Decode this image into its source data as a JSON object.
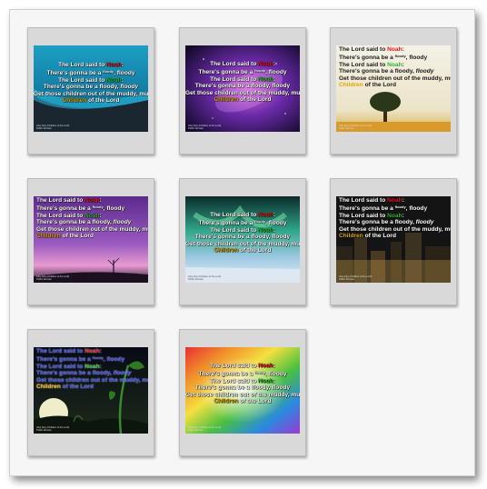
{
  "colors": {
    "noah_red": "#e01919",
    "floody_green": "#2bb52b",
    "muddy_gold": "#e0a400"
  },
  "gallery": [
    {
      "name": "Teal wave",
      "lines": [
        "The Lord said to",
        "Noah",
        ":",
        "There's gonna be a",
        "floody",
        ", floody",
        "The Lord said to",
        "Noah",
        ":",
        "There's gonna be a floody,",
        "floody",
        "Get those children out of the muddy, muddy",
        "Children",
        "of the Lord"
      ],
      "caption": [
        "Arky Arky (Children of the Lord)",
        "Public Domain"
      ]
    },
    {
      "name": "Purple galaxy",
      "lines": [
        "The Lord said to",
        "Noah",
        ":",
        "There's gonna be a",
        "floody",
        ", floody",
        "The Lord said to",
        "Noah",
        ":",
        "There's gonna be a floody, floody",
        "Get those children out of the muddy, muddy",
        "Children",
        "of the Lord"
      ],
      "caption": [
        "Arky Arky (Children of the Lord)",
        "Public Domain"
      ]
    },
    {
      "name": "Tree",
      "lines": [
        "The Lord said to",
        "Noah",
        ":",
        "There's gonna be a",
        "floody",
        ", floody",
        "The Lord said to",
        "Noah",
        ":",
        "There's gonna be a floody,",
        "floody",
        "Get those children out of the muddy, muddy",
        "Children",
        "of the Lord"
      ],
      "caption": [
        "Arky Arky (Children of the Lord)",
        "Public Domain"
      ]
    },
    {
      "name": "Purple sunset",
      "lines": [
        "The Lord said to",
        "Noah",
        ":",
        "There's gonna be a",
        "floody",
        ", floody",
        "The Lord said to",
        "Noah",
        ":",
        "There's gonna be a floody,",
        "floody",
        "Get those children out of the muddy, muddy",
        "Children",
        "of the Lord"
      ],
      "caption": [
        "Arky Arky (Children of the Lord)",
        "Public Domain"
      ]
    },
    {
      "name": "Aurora",
      "lines": [
        "The Lord said to",
        "Noah",
        ":",
        "There's gonna be a",
        "floody",
        ", floody",
        "The Lord said to",
        "Noah",
        ":",
        "There's gonna be a floody, floody",
        "Get those children out of the muddy, muddy",
        "Children",
        "of the Lord"
      ],
      "caption": [
        "Arky Arky (Children of the Lord)",
        "Public Domain"
      ]
    },
    {
      "name": "City night",
      "lines": [
        "The Lord said to",
        "Noah",
        ":",
        "There's gonna be a",
        "floody",
        ", floody",
        "The Lord said to",
        "Noah",
        ":",
        "There's gonna be a floody,",
        "floody",
        "Get those children out of the muddy, muddy",
        "Children",
        "of the Lord"
      ],
      "caption": [
        "Arky Arky (Children of the Lord)",
        "Public Domain"
      ]
    },
    {
      "name": "Night garden",
      "lines": [
        "The Lord said to",
        "Noah",
        ":",
        "There's gonna be a",
        "floody",
        ", floody",
        "The Lord said to",
        "Noah",
        ":",
        "There's gonna be a floody,",
        "floody",
        "Get those children out of the muddy, muddy",
        "Children",
        "of the Lord"
      ],
      "caption": [
        "Arky Arky (Children of the Lord)",
        "Public Domain"
      ]
    },
    {
      "name": "Rainbow burst",
      "lines": [
        "The Lord said to",
        "Noah",
        ":",
        "There's gonna be a",
        "floody",
        ", floody",
        "The Lord said to",
        "Noah",
        ":",
        "There's gonna be a floody, floody",
        "Get those children out of the muddy, muddy",
        "Children",
        "of the Lord"
      ],
      "caption": [
        "Arky Arky (Children of the Lord)",
        "Public Domain"
      ]
    }
  ]
}
